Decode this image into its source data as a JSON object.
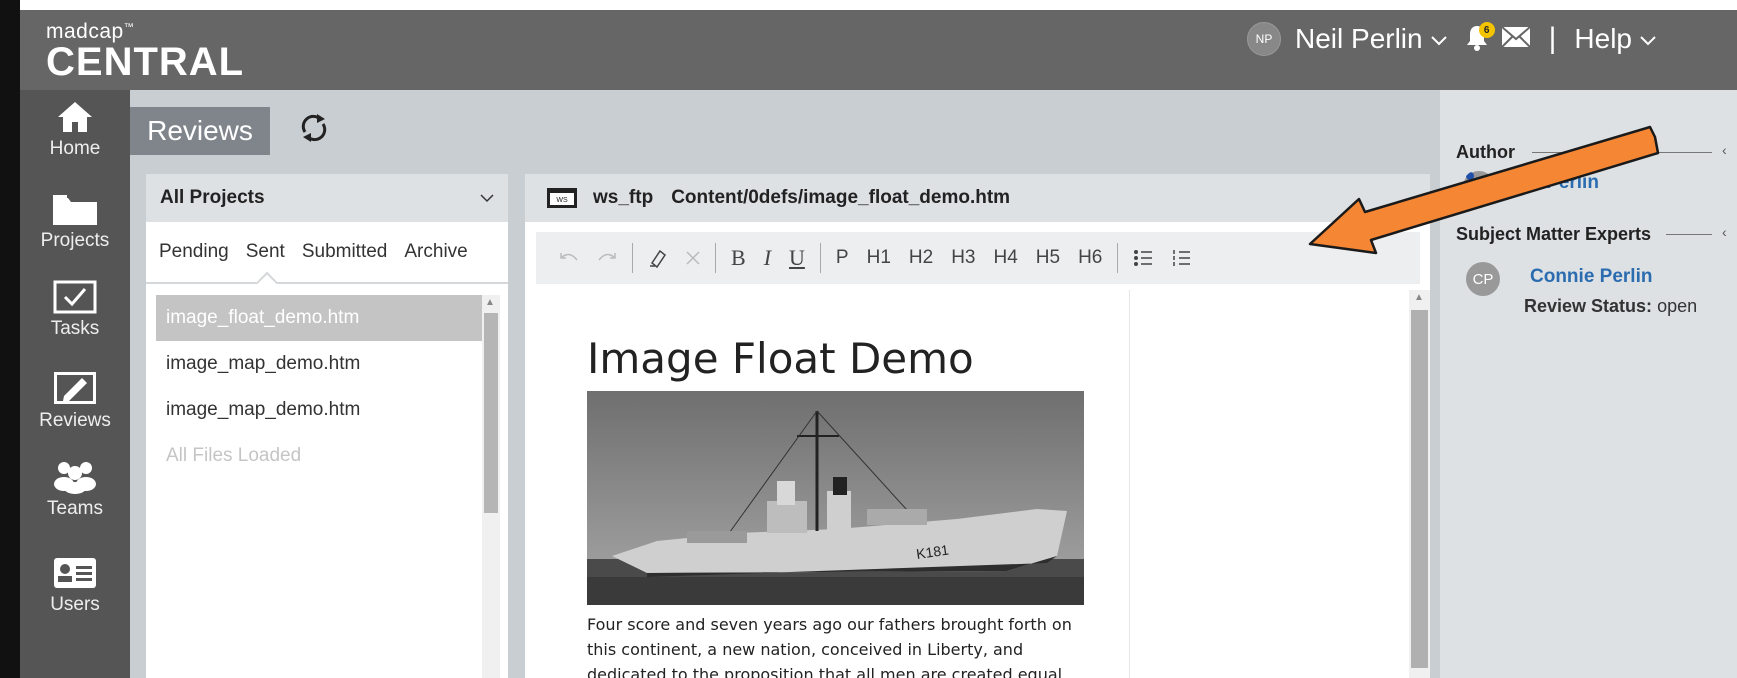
{
  "header": {
    "logo_small": "madcap",
    "logo_tm": "™",
    "logo_big": "CENTRAL",
    "user_initials": "NP",
    "user_name": "Neil Perlin",
    "notification_count": "6",
    "help_label": "Help"
  },
  "nav": {
    "items": [
      {
        "label": "Home",
        "icon": "home-icon"
      },
      {
        "label": "Projects",
        "icon": "folder-icon"
      },
      {
        "label": "Tasks",
        "icon": "checkbox-icon"
      },
      {
        "label": "Reviews",
        "icon": "review-pen-icon"
      },
      {
        "label": "Teams",
        "icon": "team-icon"
      },
      {
        "label": "Users",
        "icon": "id-card-icon"
      }
    ]
  },
  "reviews": {
    "tab_label": "Reviews",
    "project_filter": "All Projects",
    "status_tabs": [
      "Pending",
      "Sent",
      "Submitted",
      "Archive"
    ],
    "selected_status_tab": "Sent",
    "files": [
      "image_float_demo.htm",
      "image_map_demo.htm",
      "image_map_demo.htm"
    ],
    "files_loaded_text": "All Files Loaded"
  },
  "document": {
    "project_icon_text": "WS",
    "project": "ws_ftp",
    "path": "Content/0defs/image_float_demo.htm",
    "toolbar": {
      "paragraph": "P",
      "headings": [
        "H1",
        "H2",
        "H3",
        "H4",
        "H5",
        "H6"
      ],
      "bold": "B",
      "italic": "I",
      "underline": "U"
    },
    "title": "Image Float Demo",
    "image_caption_hull": "K181",
    "body_lines": [
      "Four score and seven years ago our fathers brought forth on",
      "this continent, a new nation, conceived in Liberty, and",
      "dedicated to the proposition that all men are created equal."
    ]
  },
  "right_panel": {
    "author_heading": "Author",
    "author_name": "Neil Perlin",
    "sme_heading": "Subject Matter Experts",
    "sme_initials": "CP",
    "sme_name": "Connie Perlin",
    "review_status_label": "Review Status:",
    "review_status_value": "open"
  },
  "colors": {
    "header_bg": "#666666",
    "nav_bg": "#555555",
    "content_bg": "#c9ced3",
    "link_blue": "#2b6cb0",
    "annotation_arrow": "#f58634"
  }
}
